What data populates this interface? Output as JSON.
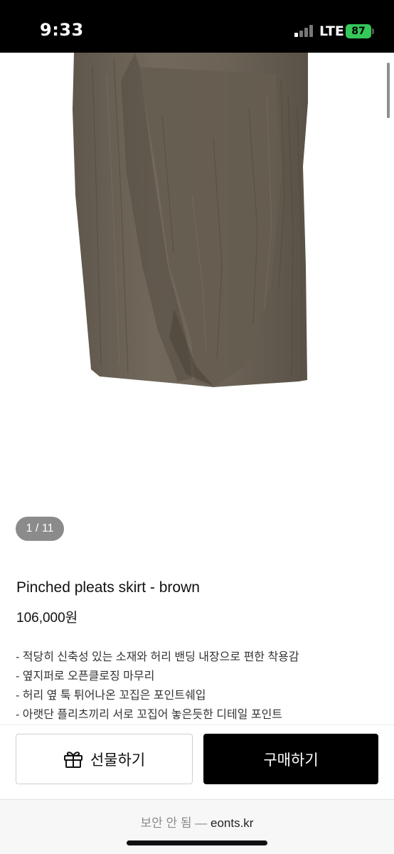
{
  "status_bar": {
    "time": "9:33",
    "network": "LTE",
    "battery": "87",
    "battery_color": "#34c759"
  },
  "product": {
    "image_description_icon": "skirt-image",
    "image_counter": "1 / 11",
    "title": "Pinched pleats skirt - brown",
    "price": "106,000원",
    "description": [
      "- 적당히 신축성 있는 소재와 허리 밴딩 내장으로 편한 착용감",
      "- 옆지퍼로 오픈클로징 마무리",
      "- 허리 옆 툭 튀어나온 꼬집은 포인트쉐입",
      "- 아랫단 플리츠끼리 서로 꼬집어 놓은듯한 디테일 포인트"
    ]
  },
  "actions": {
    "gift_label": "선물하기",
    "gift_icon": "gift-icon",
    "buy_label": "구매하기"
  },
  "browser": {
    "security_text": "보안 안 됨 —",
    "domain": "eonts.kr"
  },
  "colors": {
    "skirt": "#6e6559",
    "buy_button": "#000000",
    "counter_badge": "#8b8b8b"
  }
}
